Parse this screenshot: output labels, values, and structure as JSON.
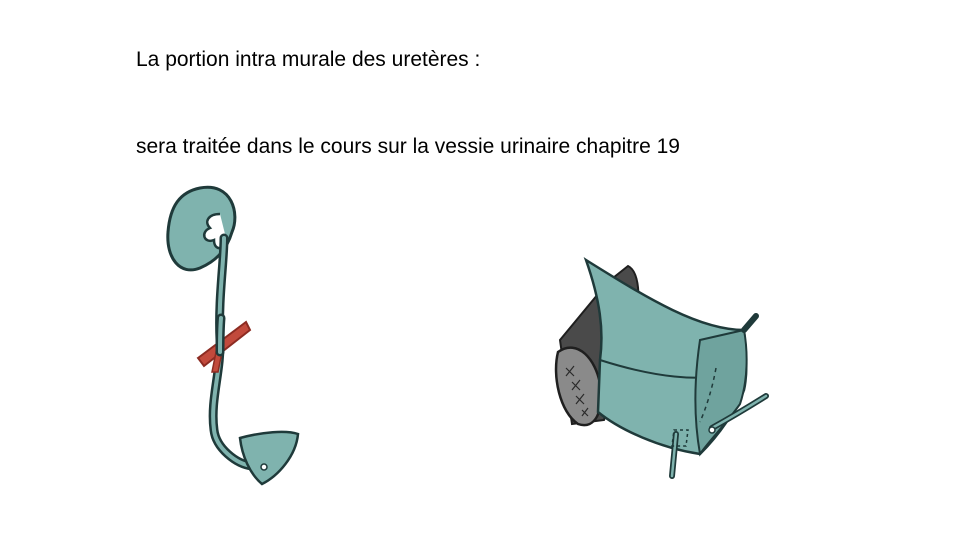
{
  "slide": {
    "title": "La portion intra murale des uretères :",
    "body": "sera traitée dans le cours sur la vessie urinaire chapitre 19"
  },
  "colors": {
    "organ_fill": "#7fb3ae",
    "organ_dark": "#5f9993",
    "outline": "#1f3a3a",
    "artery": "#c24a3c",
    "artery_dark": "#8c2b22",
    "rectum_fill": "#4a4a4a",
    "rectum_light": "#8a8a8a"
  },
  "icons": {
    "left": "kidney-ureter-bladder-icon",
    "right": "bladder-cross-section-icon"
  }
}
